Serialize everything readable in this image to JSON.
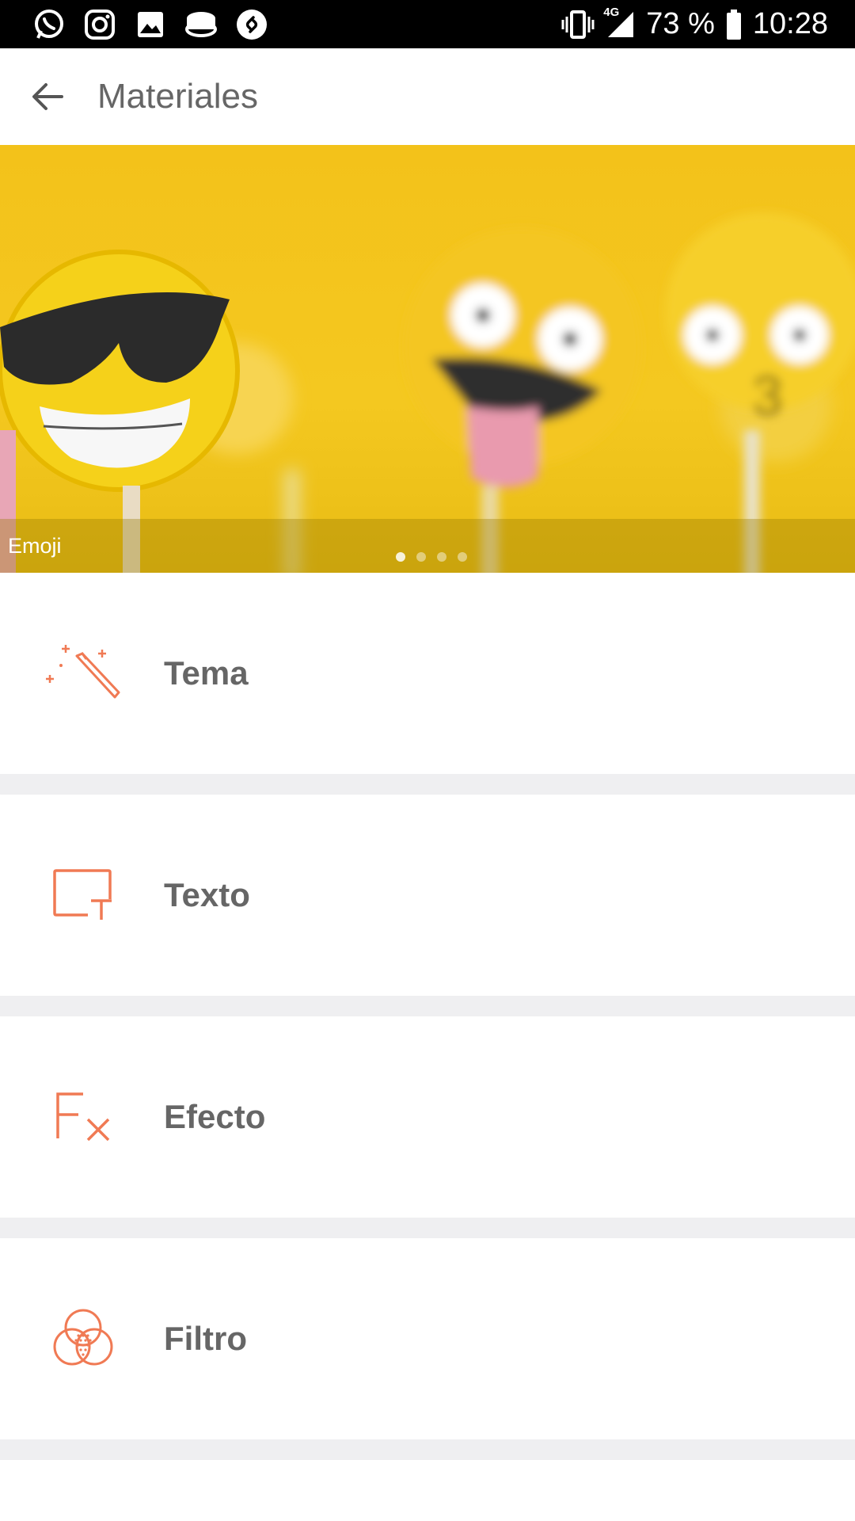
{
  "status_bar": {
    "battery": "73 %",
    "time": "10:28",
    "network": "4G",
    "left_icons": [
      "whatsapp-icon",
      "instagram-icon",
      "gallery-icon",
      "app-icon",
      "shazam-icon"
    ]
  },
  "header": {
    "title": "Materiales"
  },
  "banner": {
    "caption": "Emoji",
    "pages": 4,
    "active_page": 1
  },
  "menu": {
    "items": [
      {
        "label": "Tema",
        "icon": "magic-wand-icon"
      },
      {
        "label": "Texto",
        "icon": "text-box-icon"
      },
      {
        "label": "Efecto",
        "icon": "fx-icon"
      },
      {
        "label": "Filtro",
        "icon": "filter-circles-icon"
      }
    ]
  },
  "colors": {
    "accent": "#f07a54",
    "banner_yellow": "#f3c21a",
    "text": "#666666",
    "separator": "#efeff1"
  }
}
